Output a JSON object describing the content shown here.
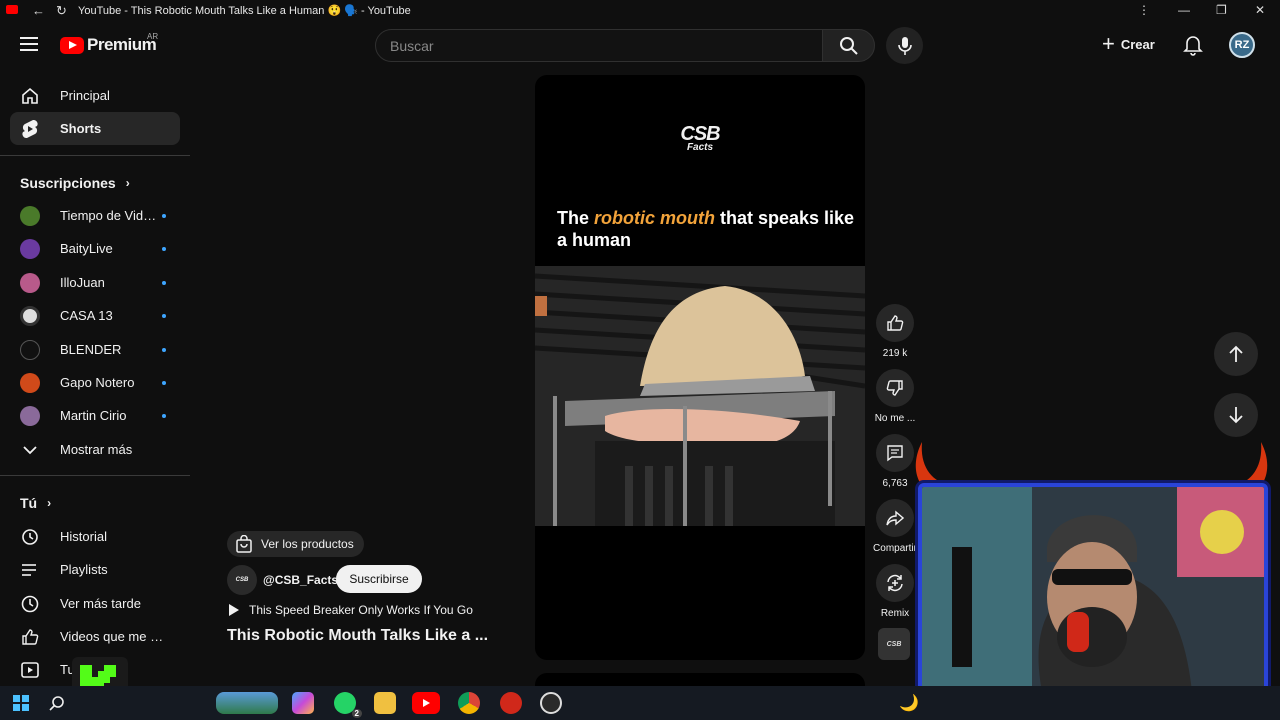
{
  "window": {
    "title": "YouTube - This Robotic Mouth Talks Like a Human 😲 🗣️ - YouTube",
    "back": "←",
    "reload": "↻",
    "menu": "⋮",
    "minimize": "—",
    "restore": "❐",
    "close": "✕"
  },
  "header": {
    "logo_text": "Premium",
    "region": "AR",
    "search_placeholder": "Buscar",
    "create_label": "Crear",
    "avatar_initials": "RZ"
  },
  "sidebar": {
    "main": [
      {
        "label": "Principal",
        "icon": "home-icon"
      },
      {
        "label": "Shorts",
        "icon": "shorts-icon",
        "active": true
      }
    ],
    "subs_heading": "Suscripciones",
    "subscriptions": [
      {
        "label": "Tiempo de Videojuegos",
        "color": "#4a7a2a"
      },
      {
        "label": "BaityLive",
        "color": "#6a3aa0"
      },
      {
        "label": "IlloJuan",
        "color": "#b85a8a"
      },
      {
        "label": "CASA 13",
        "color": "#dddddd"
      },
      {
        "label": "BLENDER",
        "color": "#111111"
      },
      {
        "label": "Gapo Notero",
        "color": "#d04a1a"
      },
      {
        "label": "Martin Cirio",
        "color": "#8a6a9a"
      }
    ],
    "show_more": "Mostrar más",
    "you_heading": "Tú",
    "you_items": [
      {
        "label": "Historial",
        "icon": "history-icon"
      },
      {
        "label": "Playlists",
        "icon": "playlist-icon"
      },
      {
        "label": "Ver más tarde",
        "icon": "clock-icon"
      },
      {
        "label": "Videos que me gustaron",
        "icon": "like-icon"
      },
      {
        "label": "Tus videos",
        "icon": "video-icon"
      }
    ]
  },
  "short": {
    "brand_line1": "CSB",
    "brand_line2": "Facts",
    "headline_pre": "The ",
    "headline_highlight": "robotic mouth",
    "headline_post": " that speaks like a human",
    "products_label": "Ver los productos",
    "channel_handle": "@CSB_Facts",
    "subscribe_label": "Suscribirse",
    "related_label": "This Speed Breaker Only Works If You Go",
    "video_title": "This Robotic Mouth Talks Like a ..."
  },
  "actions": {
    "likes": "219 k",
    "dislike": "No me ...",
    "comments": "6,763",
    "share": "Compartir",
    "remix": "Remix",
    "channel_thumb": "CSB"
  },
  "taskbar": {
    "whatsapp_badge": "2"
  },
  "colors": {
    "accent_red": "#ff0000",
    "highlight_orange": "#f2a33a",
    "sub_dot": "#3ea6ff"
  }
}
